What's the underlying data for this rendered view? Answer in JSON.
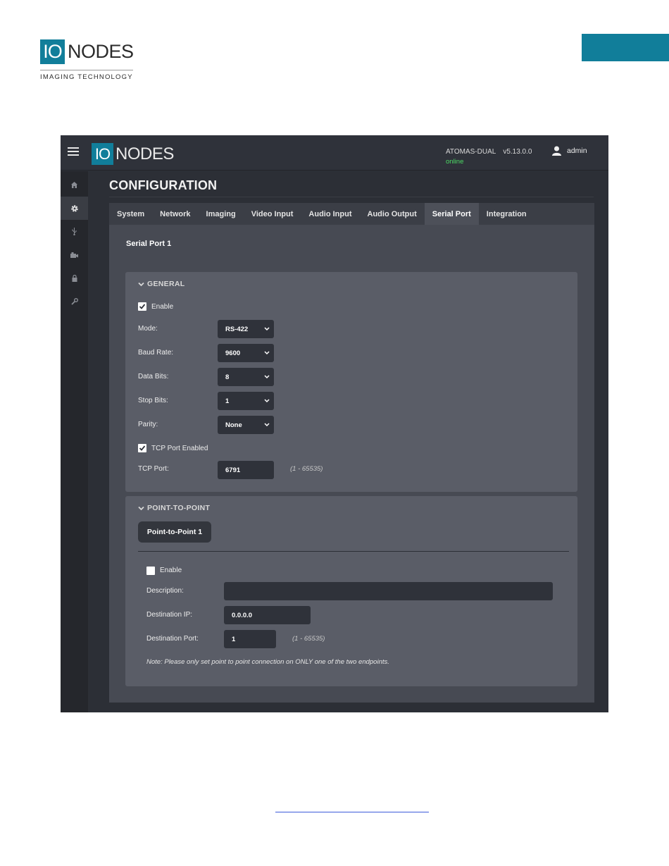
{
  "doc": {
    "logo_io": "IO",
    "logo_nodes": "NODES",
    "logo_tagline": "IMAGING TECHNOLOGY"
  },
  "header": {
    "logo_io": "IO",
    "logo_nodes": "NODES",
    "device_name": "ATOMAS-DUAL",
    "version": "v5.13.0.0",
    "status": "online",
    "user": "admin"
  },
  "sidebar": {
    "items": [
      {
        "icon": "home-icon",
        "glyph": "⌂"
      },
      {
        "icon": "gear-icon",
        "glyph": "⚙"
      },
      {
        "icon": "usb-icon",
        "glyph": "⚲"
      },
      {
        "icon": "camera-icon",
        "glyph": "▰"
      },
      {
        "icon": "lock-icon",
        "glyph": "🔒︎"
      },
      {
        "icon": "wrench-icon",
        "glyph": "🔧︎"
      }
    ]
  },
  "page": {
    "title": "CONFIGURATION",
    "tabs": [
      "System",
      "Network",
      "Imaging",
      "Video Input",
      "Audio Input",
      "Audio Output",
      "Serial Port",
      "Integration"
    ],
    "active_tab": "Serial Port",
    "subtitle": "Serial Port 1"
  },
  "general": {
    "heading": "GENERAL",
    "enable_label": "Enable",
    "enable_checked": true,
    "mode_label": "Mode:",
    "mode_value": "RS-422",
    "baud_label": "Baud Rate:",
    "baud_value": "9600",
    "data_bits_label": "Data Bits:",
    "data_bits_value": "8",
    "stop_bits_label": "Stop Bits:",
    "stop_bits_value": "1",
    "parity_label": "Parity:",
    "parity_value": "None",
    "tcp_enabled_label": "TCP Port Enabled",
    "tcp_enabled_checked": true,
    "tcp_port_label": "TCP Port:",
    "tcp_port_value": "6791",
    "tcp_port_range": "(1 - 65535)"
  },
  "p2p": {
    "heading": "POINT-TO-POINT",
    "tab_label": "Point-to-Point 1",
    "enable_label": "Enable",
    "enable_checked": false,
    "description_label": "Description:",
    "description_value": "",
    "dest_ip_label": "Destination IP:",
    "dest_ip_value": "0.0.0.0",
    "dest_port_label": "Destination Port:",
    "dest_port_value": "1",
    "dest_port_range": "(1 - 65535)",
    "note": "Note: Please only set point to point connection on ONLY one of the two endpoints."
  },
  "colors": {
    "brand": "#117e9a",
    "online": "#4cd964"
  }
}
